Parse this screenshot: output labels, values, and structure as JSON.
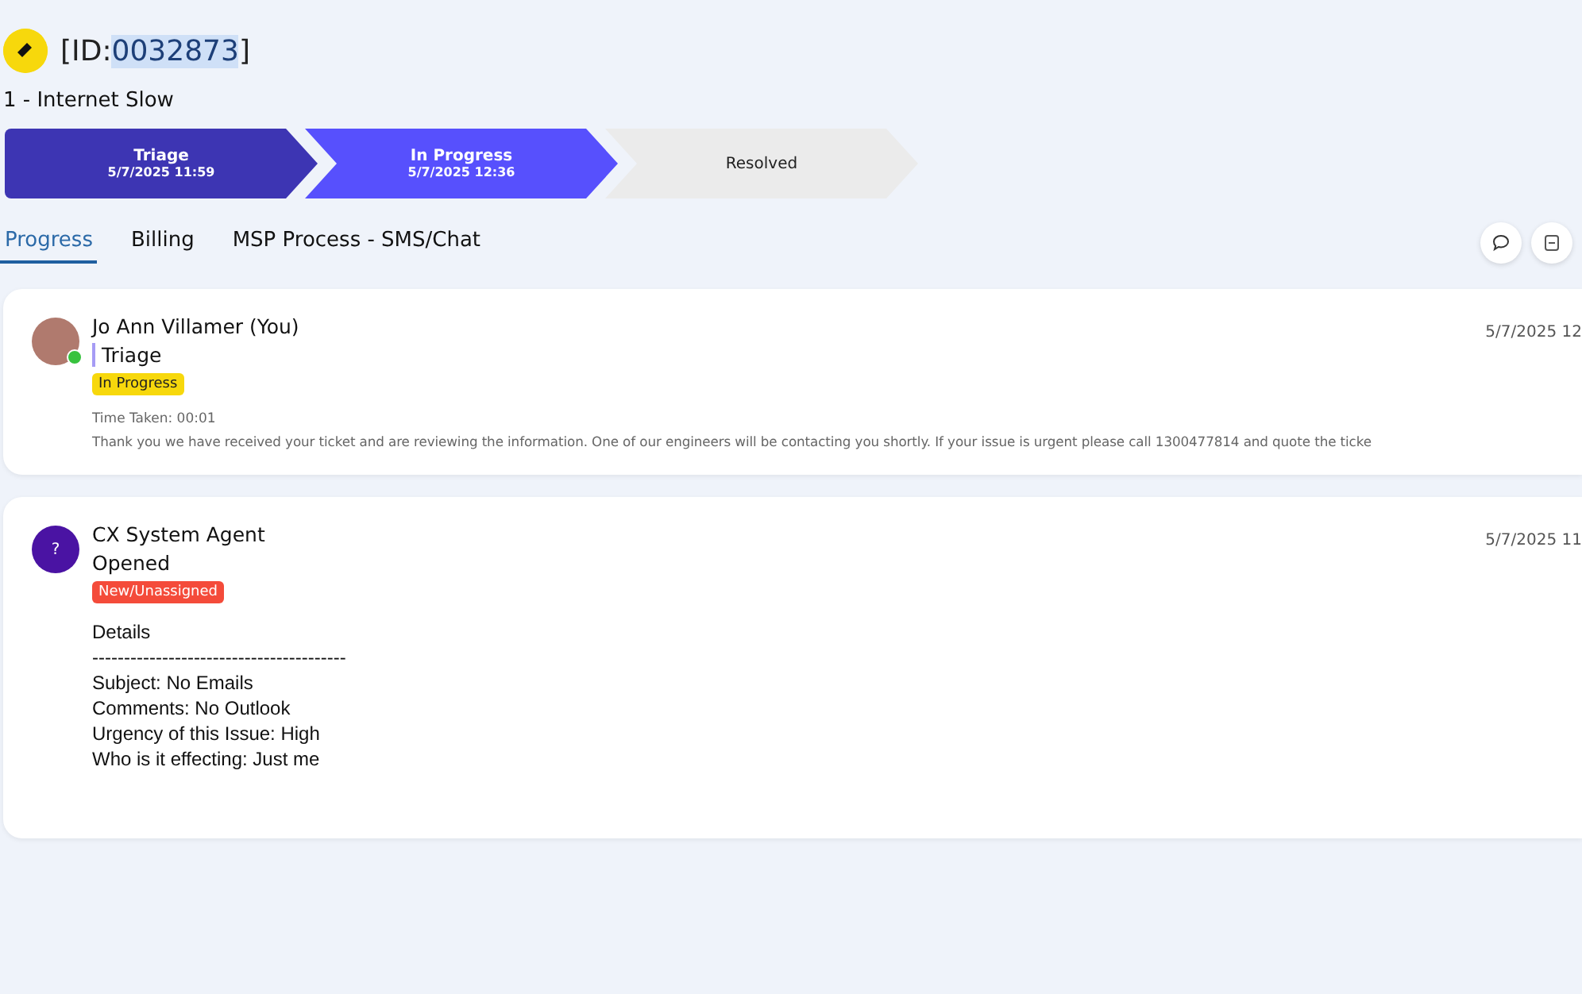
{
  "ticket": {
    "id_prefix": "[ID:",
    "id_number": "0032873",
    "id_suffix": "]",
    "title": "1 - Internet Slow"
  },
  "stages": [
    {
      "label": "Triage",
      "date": "5/7/2025 11:59",
      "selected": false
    },
    {
      "label": "In Progress",
      "date": "5/7/2025 12:36",
      "selected": true
    },
    {
      "label": "Resolved",
      "selected": false
    }
  ],
  "tabs": [
    {
      "label": "Progress",
      "selected": true
    },
    {
      "label": "Billing",
      "selected": false
    },
    {
      "label": "MSP Process - SMS/Chat",
      "selected": false
    }
  ],
  "activities": [
    {
      "author": "Jo Ann Villamer (You)",
      "avatar": {
        "kind": "photo"
      },
      "online": true,
      "stage": "Triage",
      "stage_marked": true,
      "status": {
        "label": "In Progress",
        "color": "#f7d80c"
      },
      "time": "5/7/2025 12",
      "time_taken": "Time Taken: 00:01",
      "message": "Thank you we have received your ticket and are reviewing the information. One of our engineers will be contacting you shortly. If your issue is urgent please call 1300477814 and quote the ticke"
    },
    {
      "author": "CX System Agent",
      "avatar": {
        "kind": "letter",
        "text": "?"
      },
      "online": false,
      "stage": "Opened",
      "stage_marked": false,
      "status": {
        "label": "New/Unassigned",
        "color": "#f44b3a"
      },
      "time": "5/7/2025 11",
      "details": [
        "Details",
        "----------------------------------------",
        "Subject: No Emails",
        "Comments: No Outlook",
        "Urgency of this Issue: High",
        "Who is it effecting: Just me"
      ]
    }
  ]
}
